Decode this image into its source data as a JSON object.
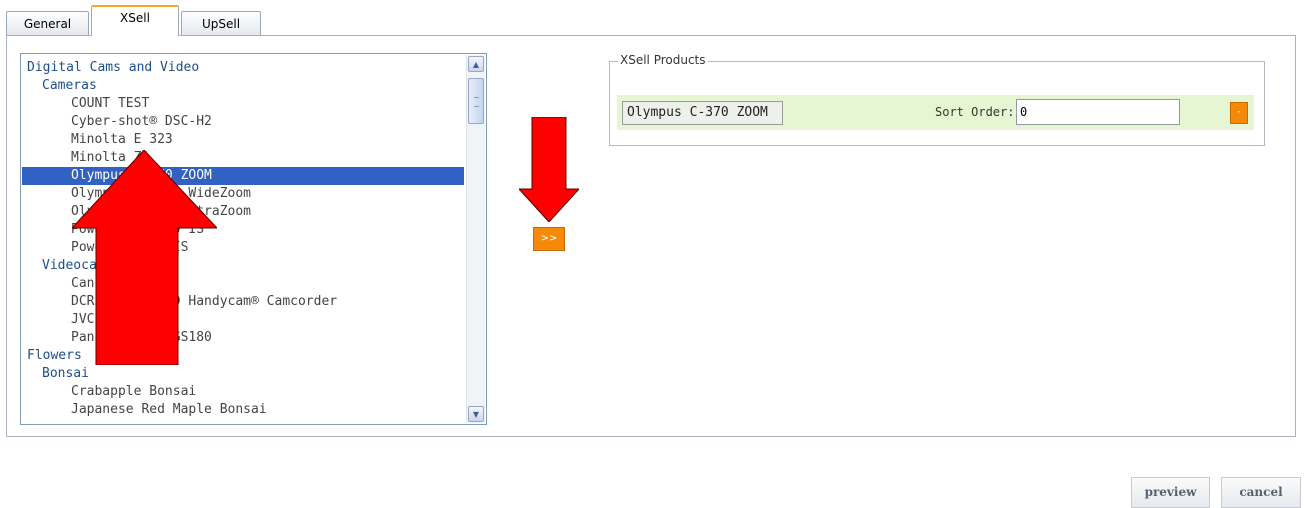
{
  "tabs": [
    {
      "label": "General"
    },
    {
      "label": "XSell"
    },
    {
      "label": "UpSell"
    }
  ],
  "category_list": {
    "items": [
      {
        "label": "Digital Cams and Video",
        "level": 0,
        "type": "category"
      },
      {
        "label": "Cameras",
        "level": 1,
        "type": "category"
      },
      {
        "label": "COUNT TEST",
        "level": 2,
        "type": "product"
      },
      {
        "label": "Cyber-shot® DSC-H2",
        "level": 2,
        "type": "product"
      },
      {
        "label": "Minolta E 323",
        "level": 2,
        "type": "product"
      },
      {
        "label": "Minolta Z1",
        "level": 2,
        "type": "product"
      },
      {
        "label": "Olympus C-370 ZOOM",
        "level": 2,
        "type": "product",
        "selected": true
      },
      {
        "label": "Olympus C-7070 WideZoom",
        "level": 2,
        "type": "product"
      },
      {
        "label": "Olympus C-770 UltraZoom",
        "level": 2,
        "type": "product"
      },
      {
        "label": "PowerShot A530 IS",
        "level": 2,
        "type": "product"
      },
      {
        "label": "PowerShot S3 IS",
        "level": 2,
        "type": "product"
      },
      {
        "label": "Videocameras",
        "level": 1,
        "type": "category"
      },
      {
        "label": "Canon MVX35i",
        "level": 2,
        "type": "product"
      },
      {
        "label": "DCR-DVD205 DVD Handycam® Camcorder",
        "level": 2,
        "type": "product"
      },
      {
        "label": "JVC GR-D720EX",
        "level": 2,
        "type": "product"
      },
      {
        "label": "Panasonic NV-GS180",
        "level": 2,
        "type": "product"
      },
      {
        "label": "Flowers",
        "level": 0,
        "type": "category"
      },
      {
        "label": "Bonsai",
        "level": 1,
        "type": "category"
      },
      {
        "label": "Crabapple Bonsai",
        "level": 2,
        "type": "product"
      },
      {
        "label": "Japanese Red Maple Bonsai",
        "level": 2,
        "type": "product"
      }
    ]
  },
  "move_button": {
    "label": ">>"
  },
  "xsell": {
    "legend": "XSell Products",
    "row": {
      "product": "Olympus C-370 ZOOM",
      "sort_label": "Sort Order:",
      "sort_value": "0",
      "remove_label": "-"
    }
  },
  "footer": {
    "preview_label": "preview",
    "cancel_label": "cancel"
  },
  "colors": {
    "accent": "#f58a09",
    "selection": "#3161c3",
    "annotation_arrow": "#ff0000",
    "row_highlight": "#e6f6d2"
  }
}
